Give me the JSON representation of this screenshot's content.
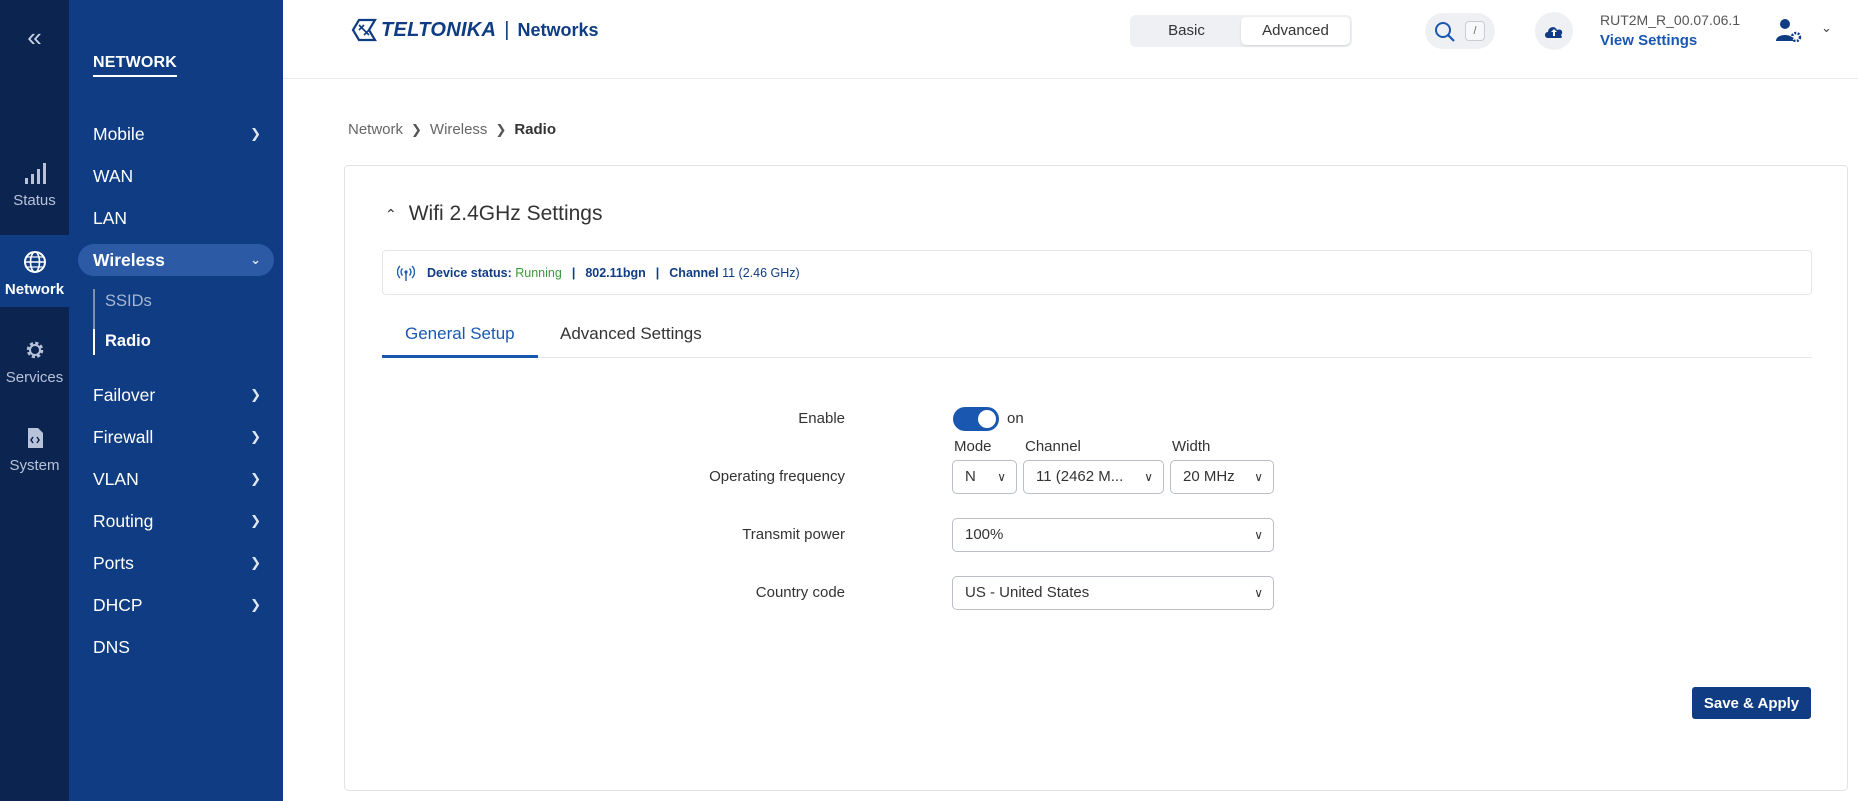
{
  "rail": {
    "collapse_icon": "double-chevron-left",
    "items": [
      {
        "label": "Status",
        "icon": "signal-bars-icon"
      },
      {
        "label": "Network",
        "icon": "globe-icon"
      },
      {
        "label": "Services",
        "icon": "gear-icon"
      },
      {
        "label": "System",
        "icon": "file-code-icon"
      }
    ]
  },
  "nav": {
    "section": "NETWORK",
    "items": [
      {
        "label": "Mobile"
      },
      {
        "label": "WAN"
      },
      {
        "label": "LAN"
      },
      {
        "label": "Wireless"
      },
      {
        "label": "Failover"
      },
      {
        "label": "Firewall"
      },
      {
        "label": "VLAN"
      },
      {
        "label": "Routing"
      },
      {
        "label": "Ports"
      },
      {
        "label": "DHCP"
      },
      {
        "label": "DNS"
      }
    ],
    "wireless_sub": [
      {
        "label": "SSIDs"
      },
      {
        "label": "Radio"
      }
    ]
  },
  "header": {
    "brand": "TELTONIKA",
    "product": "Networks",
    "separator": "|",
    "mode_basic": "Basic",
    "mode_advanced": "Advanced",
    "search_shortcut": "/",
    "firmware": "RUT2M_R_00.07.06.1",
    "view_settings": "View Settings"
  },
  "breadcrumb": [
    "Network",
    "Wireless",
    "Radio"
  ],
  "card": {
    "title": "Wifi 2.4GHz Settings",
    "status": {
      "device_status_label": "Device status:",
      "device_status_value": "Running",
      "mode": "802.11bgn",
      "channel_label": "Channel",
      "channel_value": "11 (2.46 GHz)",
      "pipe": "|"
    },
    "tabs": [
      "General Setup",
      "Advanced Settings"
    ],
    "form": {
      "enable_label": "Enable",
      "enable_value": "on",
      "op_freq_label": "Operating frequency",
      "mode_label": "Mode",
      "channel_label": "Channel",
      "width_label": "Width",
      "mode_value": "N",
      "channel_value": "11 (2462 M...",
      "width_value": "20 MHz",
      "tx_power_label": "Transmit power",
      "tx_power_value": "100%",
      "country_label": "Country code",
      "country_value": "US - United States"
    },
    "save_label": "Save & Apply"
  },
  "colors": {
    "rail_bg": "#0c2450",
    "nav_bg": "#0f3c82",
    "accent": "#1a57b0",
    "running": "#3a9a3a"
  }
}
